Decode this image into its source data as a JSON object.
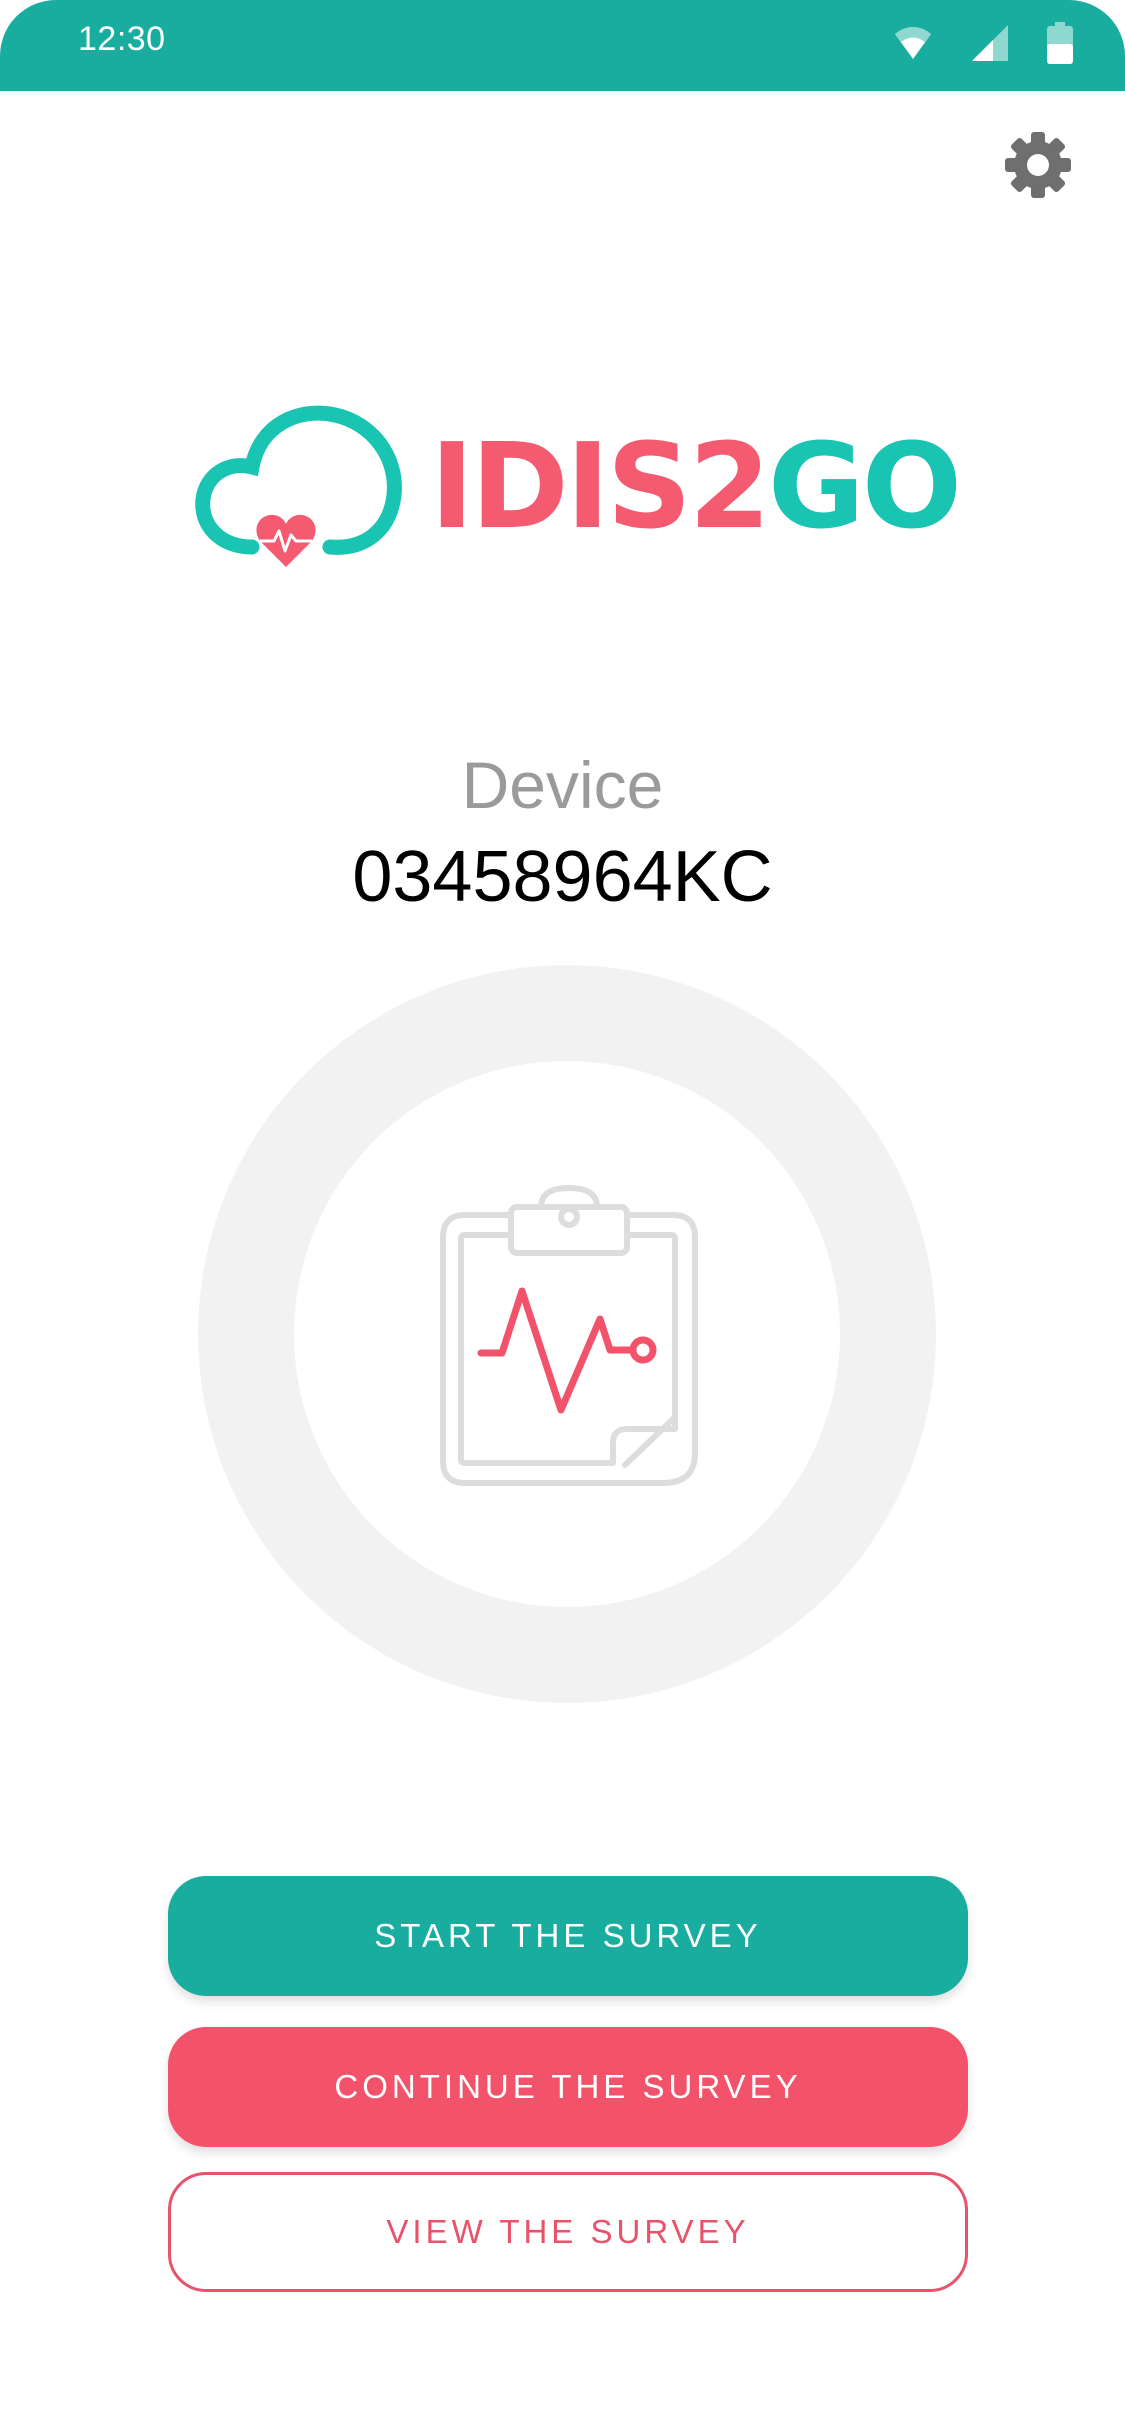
{
  "status_bar": {
    "time": "12:30",
    "icons": [
      "wifi-icon",
      "cellular-signal-icon",
      "battery-icon"
    ]
  },
  "header": {
    "settings_icon": "gear-icon"
  },
  "logo": {
    "text_part1": "IDIS2",
    "text_part2": "GO"
  },
  "device": {
    "label": "Device",
    "id": "03458964KC"
  },
  "illustration": {
    "icon": "clipboard-heartbeat-icon"
  },
  "actions": {
    "start": "START THE SURVEY",
    "continue": "CONTINUE THE SURVEY",
    "view": "VIEW THE SURVEY"
  },
  "colors": {
    "teal": "#18ad9f",
    "coral": "#f2536a",
    "logo_teal": "#19c4b2",
    "logo_pink": "#f45a70"
  }
}
